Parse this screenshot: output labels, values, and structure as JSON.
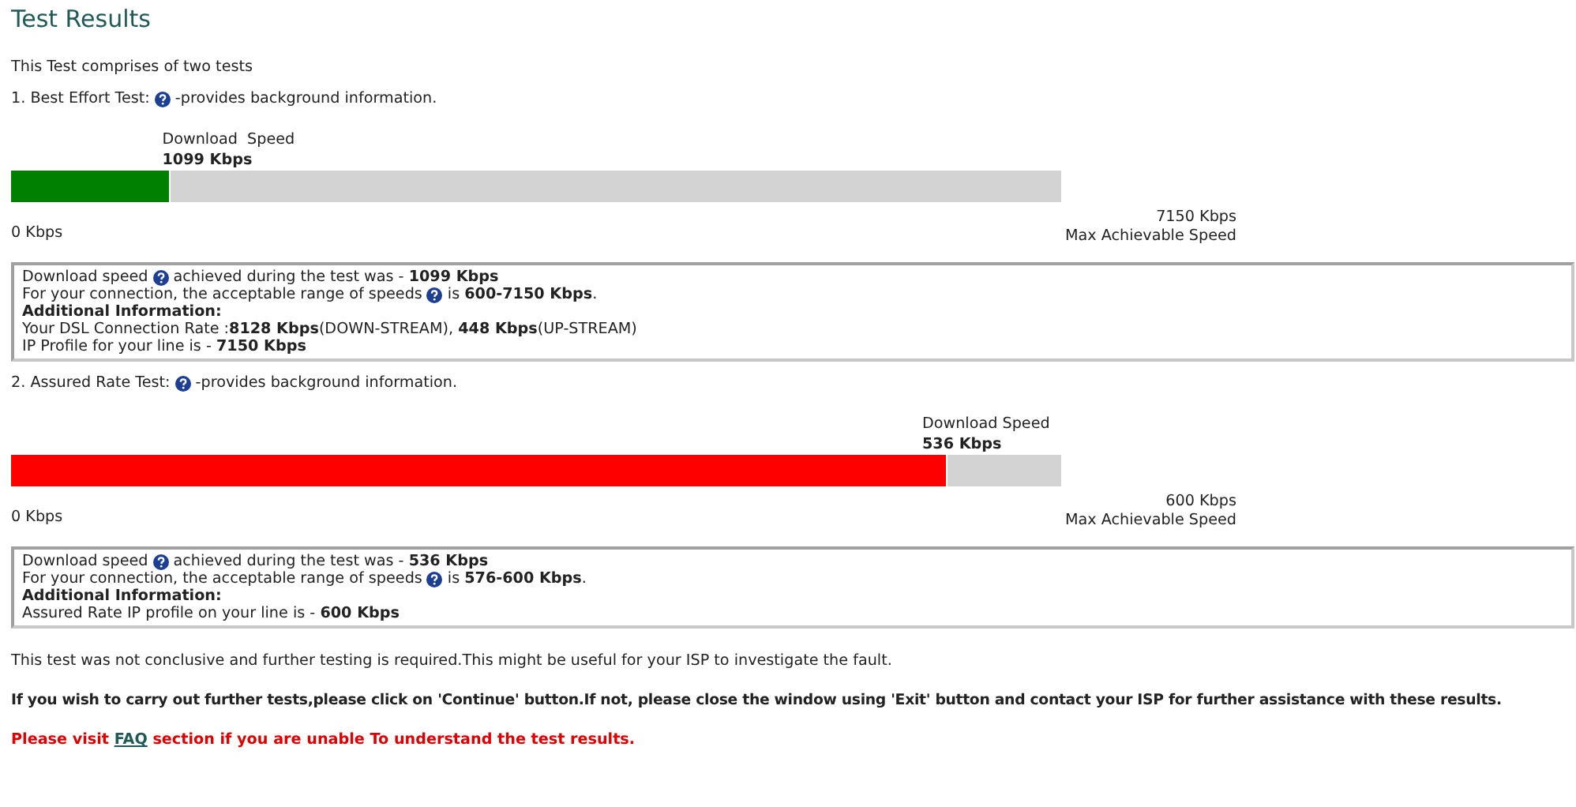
{
  "title": "Test Results",
  "intro": "This Test comprises of two tests",
  "tests": [
    {
      "heading": "1. Best Effort Test:",
      "help_note": "-provides background information.",
      "speed_label": "Download  Speed",
      "speed_value": "1099 Kbps",
      "level": 0.15,
      "color": "#008000",
      "min_label": "0 Kbps",
      "max_value": "7150 Kbps",
      "max_label": "Max Achievable Speed",
      "info": [
        {
          "kind": "help",
          "before": "Download speed",
          "after": "achieved during the test was - **1099 Kbps**"
        },
        {
          "kind": "help",
          "before": "For your connection, the acceptable range of speeds",
          "after": " is **600-7150 Kbps**."
        },
        {
          "kind": "heading",
          "text": "Additional Information:"
        },
        {
          "kind": "plain",
          "text": "Your DSL Connection Rate :**8128 Kbps**(DOWN-STREAM), **448 Kbps**(UP-STREAM)"
        },
        {
          "kind": "plain",
          "text": "IP Profile for your line is - **7150 Kbps**"
        }
      ]
    },
    {
      "heading": "2. Assured Rate Test:",
      "help_note": "-provides background information.",
      "speed_label": "Download Speed",
      "speed_value": "536 Kbps",
      "level": 0.89,
      "color": "#ff0000",
      "min_label": "0 Kbps",
      "max_value": "600 Kbps",
      "max_label": "Max Achievable Speed",
      "info": [
        {
          "kind": "help",
          "before": "Download speed",
          "after": "achieved during the test was - **536 Kbps**"
        },
        {
          "kind": "help",
          "before": "For your connection, the acceptable range of speeds",
          "after": " is **576-600 Kbps**."
        },
        {
          "kind": "heading",
          "text": "Additional Information:"
        },
        {
          "kind": "plain",
          "text": "Assured Rate IP profile on your line is - **600 Kbps**"
        }
      ]
    }
  ],
  "conclusion": "This test was not conclusive and further testing is required.This might be useful for your ISP to investigate the fault.",
  "instruction": "If you wish to carry out further tests,please click on 'Continue' button.If not, please close the window using 'Exit' button and contact your ISP for further assistance with these results.",
  "faq_note": {
    "before": "Please visit ",
    "link": "FAQ",
    "after": " section if you are unable To understand the test results."
  }
}
